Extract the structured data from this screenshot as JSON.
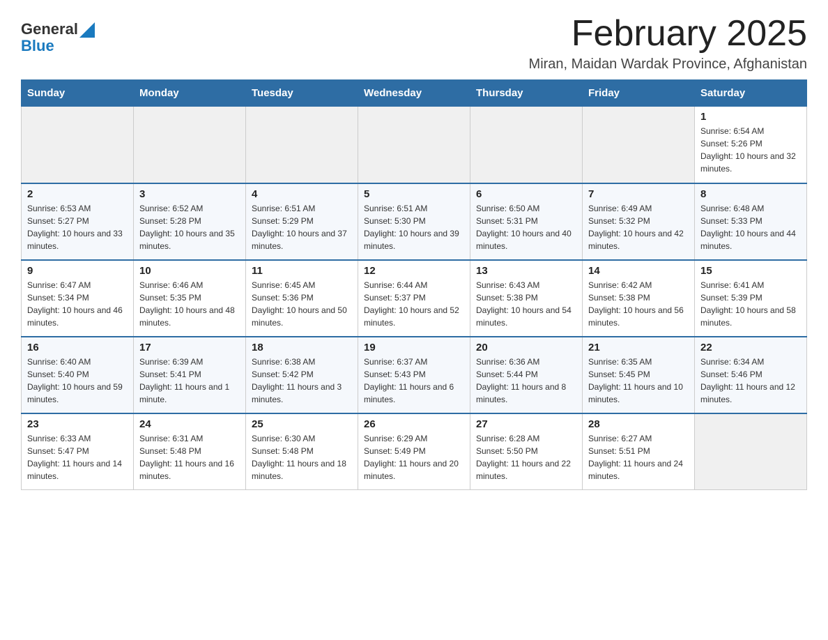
{
  "header": {
    "logo_general": "General",
    "logo_blue": "Blue",
    "month_title": "February 2025",
    "location": "Miran, Maidan Wardak Province, Afghanistan"
  },
  "days_of_week": [
    "Sunday",
    "Monday",
    "Tuesday",
    "Wednesday",
    "Thursday",
    "Friday",
    "Saturday"
  ],
  "weeks": [
    [
      {
        "day": "",
        "sunrise": "",
        "sunset": "",
        "daylight": "",
        "empty": true
      },
      {
        "day": "",
        "sunrise": "",
        "sunset": "",
        "daylight": "",
        "empty": true
      },
      {
        "day": "",
        "sunrise": "",
        "sunset": "",
        "daylight": "",
        "empty": true
      },
      {
        "day": "",
        "sunrise": "",
        "sunset": "",
        "daylight": "",
        "empty": true
      },
      {
        "day": "",
        "sunrise": "",
        "sunset": "",
        "daylight": "",
        "empty": true
      },
      {
        "day": "",
        "sunrise": "",
        "sunset": "",
        "daylight": "",
        "empty": true
      },
      {
        "day": "1",
        "sunrise": "Sunrise: 6:54 AM",
        "sunset": "Sunset: 5:26 PM",
        "daylight": "Daylight: 10 hours and 32 minutes.",
        "empty": false
      }
    ],
    [
      {
        "day": "2",
        "sunrise": "Sunrise: 6:53 AM",
        "sunset": "Sunset: 5:27 PM",
        "daylight": "Daylight: 10 hours and 33 minutes.",
        "empty": false
      },
      {
        "day": "3",
        "sunrise": "Sunrise: 6:52 AM",
        "sunset": "Sunset: 5:28 PM",
        "daylight": "Daylight: 10 hours and 35 minutes.",
        "empty": false
      },
      {
        "day": "4",
        "sunrise": "Sunrise: 6:51 AM",
        "sunset": "Sunset: 5:29 PM",
        "daylight": "Daylight: 10 hours and 37 minutes.",
        "empty": false
      },
      {
        "day": "5",
        "sunrise": "Sunrise: 6:51 AM",
        "sunset": "Sunset: 5:30 PM",
        "daylight": "Daylight: 10 hours and 39 minutes.",
        "empty": false
      },
      {
        "day": "6",
        "sunrise": "Sunrise: 6:50 AM",
        "sunset": "Sunset: 5:31 PM",
        "daylight": "Daylight: 10 hours and 40 minutes.",
        "empty": false
      },
      {
        "day": "7",
        "sunrise": "Sunrise: 6:49 AM",
        "sunset": "Sunset: 5:32 PM",
        "daylight": "Daylight: 10 hours and 42 minutes.",
        "empty": false
      },
      {
        "day": "8",
        "sunrise": "Sunrise: 6:48 AM",
        "sunset": "Sunset: 5:33 PM",
        "daylight": "Daylight: 10 hours and 44 minutes.",
        "empty": false
      }
    ],
    [
      {
        "day": "9",
        "sunrise": "Sunrise: 6:47 AM",
        "sunset": "Sunset: 5:34 PM",
        "daylight": "Daylight: 10 hours and 46 minutes.",
        "empty": false
      },
      {
        "day": "10",
        "sunrise": "Sunrise: 6:46 AM",
        "sunset": "Sunset: 5:35 PM",
        "daylight": "Daylight: 10 hours and 48 minutes.",
        "empty": false
      },
      {
        "day": "11",
        "sunrise": "Sunrise: 6:45 AM",
        "sunset": "Sunset: 5:36 PM",
        "daylight": "Daylight: 10 hours and 50 minutes.",
        "empty": false
      },
      {
        "day": "12",
        "sunrise": "Sunrise: 6:44 AM",
        "sunset": "Sunset: 5:37 PM",
        "daylight": "Daylight: 10 hours and 52 minutes.",
        "empty": false
      },
      {
        "day": "13",
        "sunrise": "Sunrise: 6:43 AM",
        "sunset": "Sunset: 5:38 PM",
        "daylight": "Daylight: 10 hours and 54 minutes.",
        "empty": false
      },
      {
        "day": "14",
        "sunrise": "Sunrise: 6:42 AM",
        "sunset": "Sunset: 5:38 PM",
        "daylight": "Daylight: 10 hours and 56 minutes.",
        "empty": false
      },
      {
        "day": "15",
        "sunrise": "Sunrise: 6:41 AM",
        "sunset": "Sunset: 5:39 PM",
        "daylight": "Daylight: 10 hours and 58 minutes.",
        "empty": false
      }
    ],
    [
      {
        "day": "16",
        "sunrise": "Sunrise: 6:40 AM",
        "sunset": "Sunset: 5:40 PM",
        "daylight": "Daylight: 10 hours and 59 minutes.",
        "empty": false
      },
      {
        "day": "17",
        "sunrise": "Sunrise: 6:39 AM",
        "sunset": "Sunset: 5:41 PM",
        "daylight": "Daylight: 11 hours and 1 minute.",
        "empty": false
      },
      {
        "day": "18",
        "sunrise": "Sunrise: 6:38 AM",
        "sunset": "Sunset: 5:42 PM",
        "daylight": "Daylight: 11 hours and 3 minutes.",
        "empty": false
      },
      {
        "day": "19",
        "sunrise": "Sunrise: 6:37 AM",
        "sunset": "Sunset: 5:43 PM",
        "daylight": "Daylight: 11 hours and 6 minutes.",
        "empty": false
      },
      {
        "day": "20",
        "sunrise": "Sunrise: 6:36 AM",
        "sunset": "Sunset: 5:44 PM",
        "daylight": "Daylight: 11 hours and 8 minutes.",
        "empty": false
      },
      {
        "day": "21",
        "sunrise": "Sunrise: 6:35 AM",
        "sunset": "Sunset: 5:45 PM",
        "daylight": "Daylight: 11 hours and 10 minutes.",
        "empty": false
      },
      {
        "day": "22",
        "sunrise": "Sunrise: 6:34 AM",
        "sunset": "Sunset: 5:46 PM",
        "daylight": "Daylight: 11 hours and 12 minutes.",
        "empty": false
      }
    ],
    [
      {
        "day": "23",
        "sunrise": "Sunrise: 6:33 AM",
        "sunset": "Sunset: 5:47 PM",
        "daylight": "Daylight: 11 hours and 14 minutes.",
        "empty": false
      },
      {
        "day": "24",
        "sunrise": "Sunrise: 6:31 AM",
        "sunset": "Sunset: 5:48 PM",
        "daylight": "Daylight: 11 hours and 16 minutes.",
        "empty": false
      },
      {
        "day": "25",
        "sunrise": "Sunrise: 6:30 AM",
        "sunset": "Sunset: 5:48 PM",
        "daylight": "Daylight: 11 hours and 18 minutes.",
        "empty": false
      },
      {
        "day": "26",
        "sunrise": "Sunrise: 6:29 AM",
        "sunset": "Sunset: 5:49 PM",
        "daylight": "Daylight: 11 hours and 20 minutes.",
        "empty": false
      },
      {
        "day": "27",
        "sunrise": "Sunrise: 6:28 AM",
        "sunset": "Sunset: 5:50 PM",
        "daylight": "Daylight: 11 hours and 22 minutes.",
        "empty": false
      },
      {
        "day": "28",
        "sunrise": "Sunrise: 6:27 AM",
        "sunset": "Sunset: 5:51 PM",
        "daylight": "Daylight: 11 hours and 24 minutes.",
        "empty": false
      },
      {
        "day": "",
        "sunrise": "",
        "sunset": "",
        "daylight": "",
        "empty": true
      }
    ]
  ]
}
